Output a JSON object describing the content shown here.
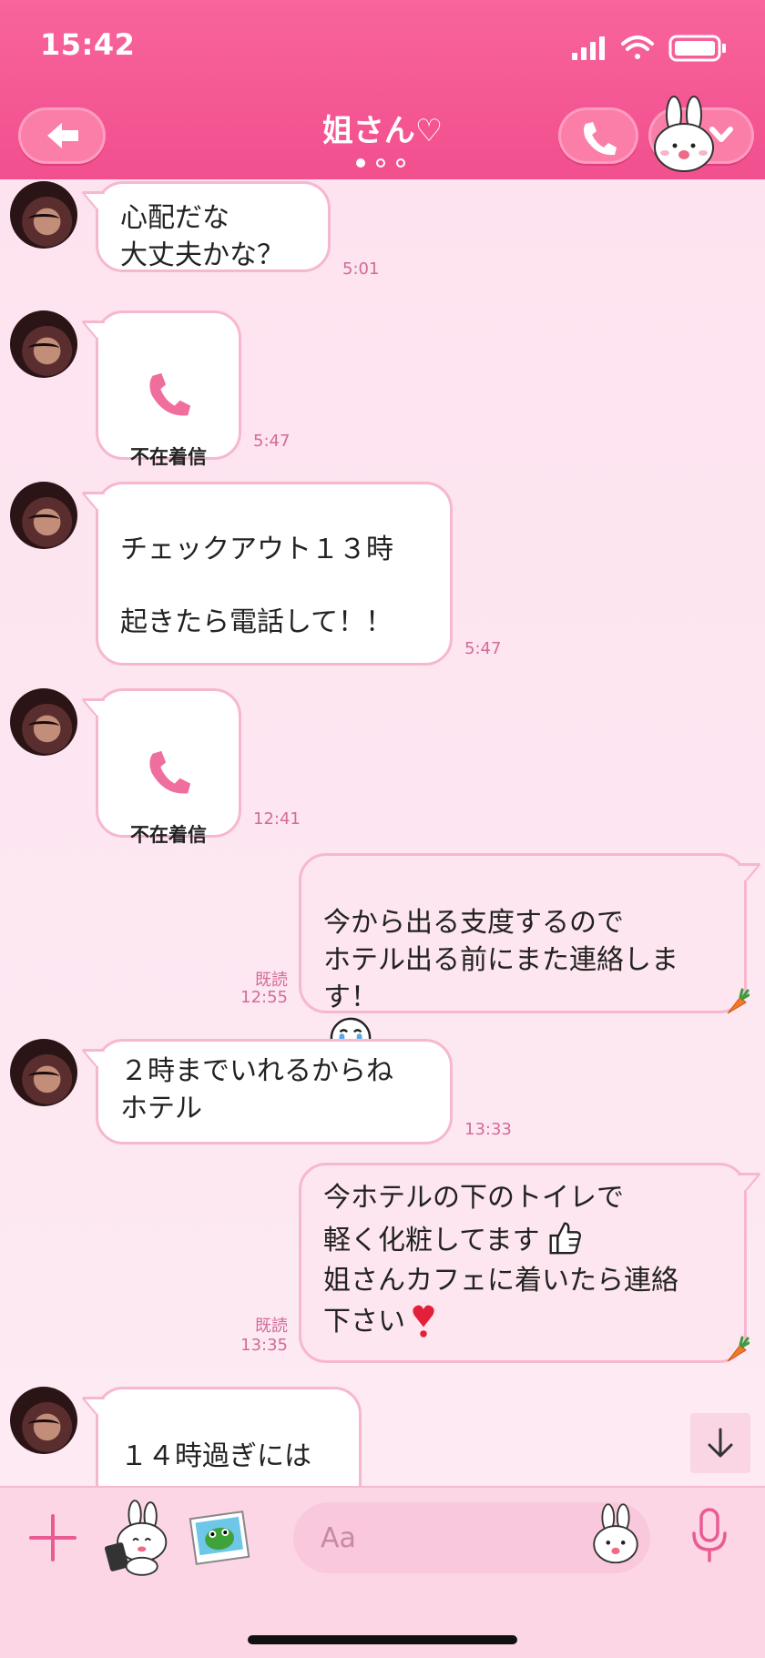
{
  "status_bar": {
    "time": "15:42"
  },
  "header": {
    "title": "姐さん♡"
  },
  "messages": [
    {
      "text": "心配だな\n大丈夫かな？",
      "time": "5:01"
    },
    {
      "label": "不在着信",
      "time": "5:47"
    },
    {
      "text": "\nチェックアウト１３時\n\n起きたら電話して！！",
      "time": "5:47"
    },
    {
      "label": "不在着信",
      "time": "12:41"
    },
    {
      "text": "今から出る支度するので\nホテル出る前にまた連絡しま\nす！",
      "read": "既読",
      "time": "12:55"
    },
    {
      "text": "２時までいれるからね\nホテル",
      "time": "13:33"
    },
    {
      "line1": "今ホテルの下のトイレで",
      "line2": "軽く化粧してます",
      "line3": "姐さんカフェに着いたら連絡",
      "line4": "下さい",
      "read": "既読",
      "time": "13:35"
    },
    {
      "text": "\n１４時過ぎには"
    }
  ],
  "footer": {
    "input_placeholder": "Aa"
  },
  "colors": {
    "header": "#f55a94",
    "bubble_border": "#f6b7cf",
    "accent": "#e95b93",
    "background": "#fdeaf3"
  }
}
